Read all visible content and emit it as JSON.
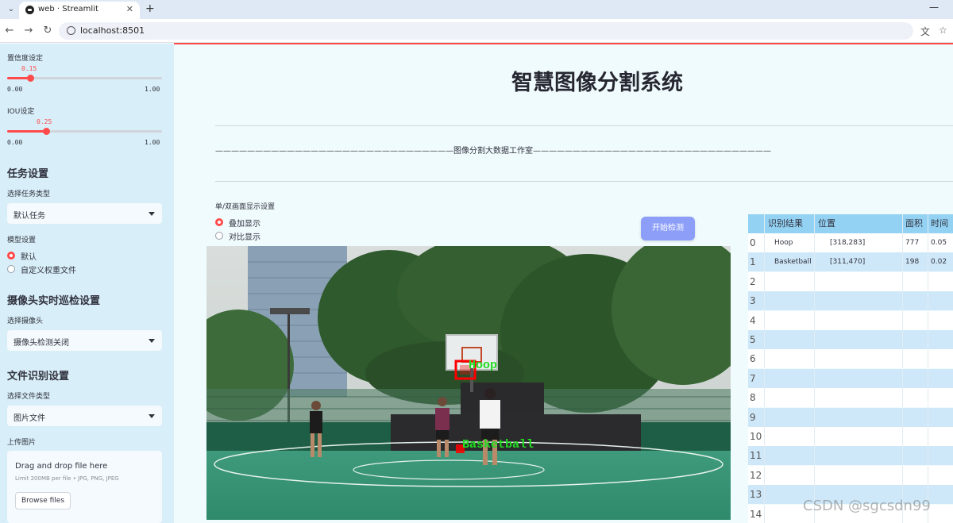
{
  "browser": {
    "tab_title": "web · Streamlit",
    "new_tab": "+",
    "url": "localhost:8501"
  },
  "sidebar": {
    "confidence_label": "置信度设定",
    "confidence_value": "0.15",
    "confidence_fraction": 0.15,
    "confidence_min": "0.00",
    "confidence_max": "1.00",
    "iou_label": "IOU设定",
    "iou_value": "0.25",
    "iou_fraction": 0.25,
    "iou_min": "0.00",
    "iou_max": "1.00",
    "task_heading": "任务设置",
    "task_type_label": "选择任务类型",
    "task_type_value": "默认任务",
    "model_label": "模型设置",
    "model_options": [
      "默认",
      "自定义权重文件"
    ],
    "model_selected": 0,
    "camera_heading": "摄像头实时巡检设置",
    "camera_label": "选择摄像头",
    "camera_value": "摄像头检测关闭",
    "file_heading": "文件识别设置",
    "file_type_label": "选择文件类型",
    "file_type_value": "图片文件",
    "upload_label": "上传图片",
    "upload_title": "Drag and drop file here",
    "upload_limit": "Limit 200MB per file • JPG, PNG, JPEG",
    "browse_label": "Browse files"
  },
  "main": {
    "title": "智慧图像分割系统",
    "subtitle": "——————————————————————————————图像分割大数据工作室——————————————————————————————",
    "display_mode_label": "单/双画面显示设置",
    "display_options": [
      "叠加显示",
      "对比显示"
    ],
    "display_selected": 0,
    "start_button": "开始检测"
  },
  "detections": {
    "hoop_label": "Hoop",
    "basketball_label": "Basketball",
    "box_color": "#ff0000",
    "label_color": "#22dd22"
  },
  "results_table": {
    "headers": [
      "识别结果",
      "位置",
      "面积",
      "时间"
    ],
    "rows": [
      {
        "index": "0",
        "result": "Hoop",
        "position": "[318,283]",
        "area": "777",
        "time": "0.05"
      },
      {
        "index": "1",
        "result": "Basketball",
        "position": "[311,470]",
        "area": "198",
        "time": "0.02"
      },
      {
        "index": "2",
        "result": "",
        "position": "",
        "area": "",
        "time": ""
      },
      {
        "index": "3",
        "result": "",
        "position": "",
        "area": "",
        "time": ""
      },
      {
        "index": "4",
        "result": "",
        "position": "",
        "area": "",
        "time": ""
      },
      {
        "index": "5",
        "result": "",
        "position": "",
        "area": "",
        "time": ""
      },
      {
        "index": "6",
        "result": "",
        "position": "",
        "area": "",
        "time": ""
      },
      {
        "index": "7",
        "result": "",
        "position": "",
        "area": "",
        "time": ""
      },
      {
        "index": "8",
        "result": "",
        "position": "",
        "area": "",
        "time": ""
      },
      {
        "index": "9",
        "result": "",
        "position": "",
        "area": "",
        "time": ""
      },
      {
        "index": "10",
        "result": "",
        "position": "",
        "area": "",
        "time": ""
      },
      {
        "index": "11",
        "result": "",
        "position": "",
        "area": "",
        "time": ""
      },
      {
        "index": "12",
        "result": "",
        "position": "",
        "area": "",
        "time": ""
      },
      {
        "index": "13",
        "result": "",
        "position": "",
        "area": "",
        "time": ""
      },
      {
        "index": "14",
        "result": "",
        "position": "",
        "area": "",
        "time": ""
      }
    ]
  },
  "watermark": "CSDN @sgcsdn99",
  "colors": {
    "accent": "#ff4b4b",
    "button": "#8c9ef8",
    "sidebar_bg": "#d8eef8",
    "table_header": "#94d2f4"
  }
}
